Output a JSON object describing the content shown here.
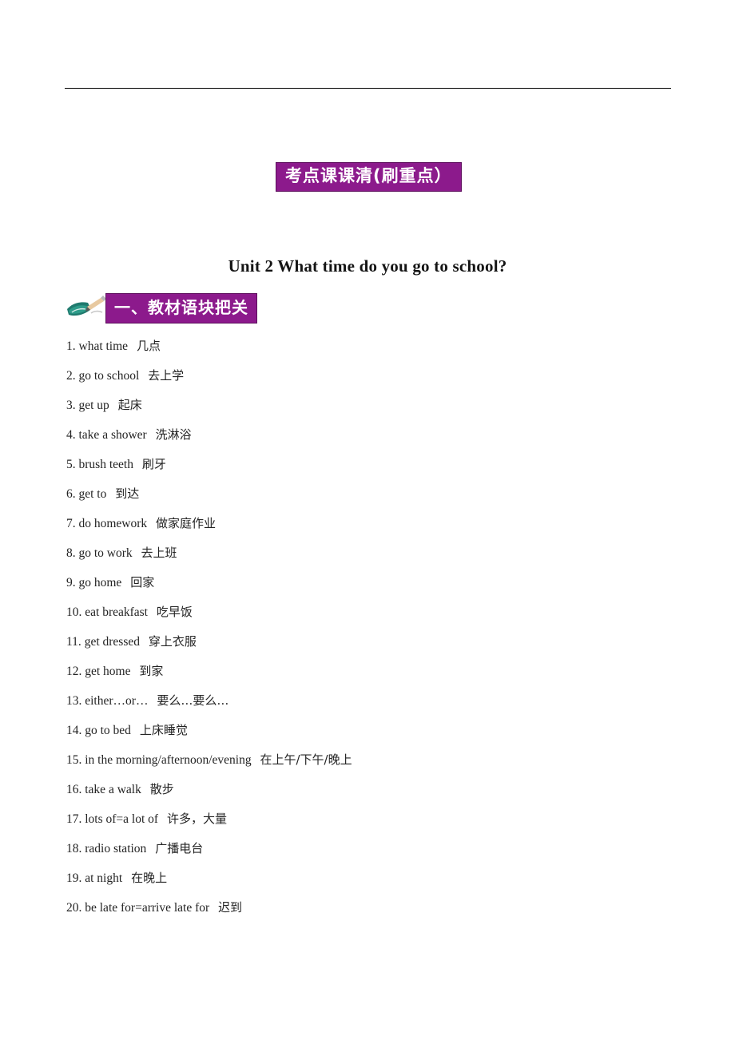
{
  "page": {
    "background_color": "#ffffff",
    "rule_color": "#000000"
  },
  "badges": {
    "accent_bg": "#8c1a8c",
    "accent_border": "#5d0f5d",
    "accent_text": "#ffffff",
    "main_label": "考点课课清(刷重点）",
    "section_label": "一、教材语块把关"
  },
  "title": {
    "text": "Unit 2 What time do you go to school?"
  },
  "icons": {
    "section_icon": "book-pen-icon"
  },
  "vocabulary": {
    "items": [
      {
        "num": "1.",
        "en": "what time",
        "zh": "几点"
      },
      {
        "num": "2.",
        "en": "go to school",
        "zh": "去上学"
      },
      {
        "num": "3.",
        "en": "get up",
        "zh": "起床"
      },
      {
        "num": "4.",
        "en": "take a shower",
        "zh": "洗淋浴"
      },
      {
        "num": "5.",
        "en": "brush teeth",
        "zh": "刷牙"
      },
      {
        "num": "6.",
        "en": "get to",
        "zh": "到达"
      },
      {
        "num": "7.",
        "en": "do homework",
        "zh": "做家庭作业"
      },
      {
        "num": "8.",
        "en": "go to work",
        "zh": "去上班"
      },
      {
        "num": "9.",
        "en": "go home",
        "zh": "回家"
      },
      {
        "num": "10.",
        "en": "eat breakfast",
        "zh": "吃早饭"
      },
      {
        "num": "11.",
        "en": "get dressed",
        "zh": "穿上衣服"
      },
      {
        "num": "12.",
        "en": "get home",
        "zh": "到家"
      },
      {
        "num": "13.",
        "en": "either…or…",
        "zh": "要么…要么…"
      },
      {
        "num": "14.",
        "en": "go to bed",
        "zh": "上床睡觉"
      },
      {
        "num": "15.",
        "en": "in the morning/afternoon/evening",
        "zh": "在上午/下午/晚上"
      },
      {
        "num": "16.",
        "en": "take a walk",
        "zh": "散步"
      },
      {
        "num": "17.",
        "en": "lots of=a lot of",
        "zh": "许多，大量"
      },
      {
        "num": "18.",
        "en": "radio station",
        "zh": "广播电台"
      },
      {
        "num": "19.",
        "en": "at night",
        "zh": "在晚上"
      },
      {
        "num": "20.",
        "en": "be late for=arrive late for",
        "zh": "迟到"
      }
    ]
  }
}
